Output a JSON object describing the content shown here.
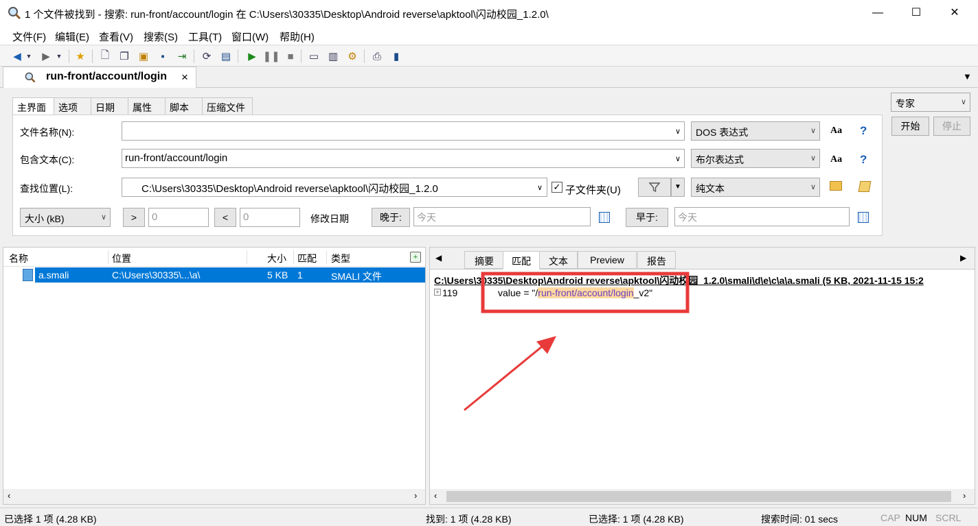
{
  "window": {
    "title": "1 个文件被找到 - 搜索: run-front/account/login 在 C:\\Users\\30335\\Desktop\\Android reverse\\apktool\\闪动校园_1.2.0\\",
    "minimize": "—",
    "maximize": "☐",
    "close": "✕"
  },
  "menu": [
    "文件(F)",
    "编辑(E)",
    "查看(V)",
    "搜索(S)",
    "工具(T)",
    "窗口(W)",
    "帮助(H)"
  ],
  "doc_tab": {
    "label": "run-front/account/login",
    "close": "×"
  },
  "inner_tabs": [
    "主界面",
    "选项",
    "日期",
    "属性",
    "脚本",
    "压缩文件"
  ],
  "form": {
    "filename_label": "文件名称(N):",
    "filename_value": "",
    "filename_mode": "DOS 表达式",
    "contains_label": "包含文本(C):",
    "contains_value": "run-front/account/login",
    "contains_mode": "布尔表达式",
    "location_label": "查找位置(L):",
    "location_value": "C:\\Users\\30335\\Desktop\\Android reverse\\apktool\\闪动校园_1.2.0",
    "subfolders_label": "子文件夹(U)",
    "subfolders_checked": true,
    "location_mode": "纯文本",
    "aa": "Aa",
    "help": "?",
    "size_label": "大小 (kB)",
    "gt": ">",
    "gt_value": "0",
    "lt": "<",
    "lt_value": "0",
    "date_label": "修改日期",
    "after_label": "晚于:",
    "after_value": "今天",
    "before_label": "早于:",
    "before_value": "今天"
  },
  "side": {
    "mode": "专家",
    "start": "开始",
    "stop": "停止"
  },
  "results": {
    "columns": [
      "名称",
      "位置",
      "大小",
      "匹配",
      "类型"
    ],
    "rows": [
      {
        "name": "a.smali",
        "location": "C:\\Users\\30335\\...\\a\\",
        "size": "5 KB",
        "matches": "1",
        "type": "SMALI 文件"
      }
    ]
  },
  "preview": {
    "tabs": [
      "摘要",
      "匹配",
      "文本",
      "Preview",
      "报告"
    ],
    "active_tab": "匹配",
    "file_header": "C:\\Users\\30335\\Desktop\\Android reverse\\apktool\\闪动校园_1.2.0\\smali\\d\\e\\c\\a\\a.smali   (5 KB,  2021-11-15 15:2",
    "line_number": "119",
    "line_prefix": "value = \"/",
    "line_match": "run-front/account/login",
    "line_suffix": "_v2\""
  },
  "status": {
    "selected_left": "已选择 1 项 (4.28 KB)",
    "found": "找到: 1 项 (4.28 KB)",
    "selected_right": "已选择: 1 项 (4.28 KB)",
    "time": "搜索时间: 01 secs",
    "cap": "CAP",
    "num": "NUM",
    "scrl": "SCRL"
  },
  "colors": {
    "selection": "#0078d7",
    "highlight": "#ffd9a0",
    "annotation": "#e83a3a"
  }
}
